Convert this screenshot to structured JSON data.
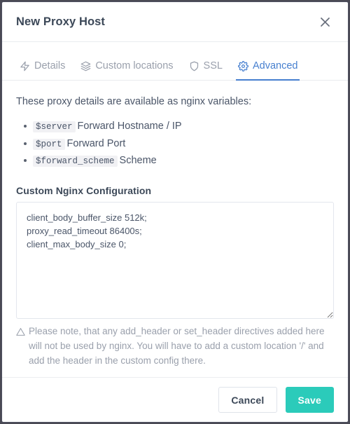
{
  "dialog": {
    "title": "New Proxy Host",
    "close_icon": "close-icon"
  },
  "tabs": [
    {
      "label": "Details",
      "icon": "zap-icon",
      "active": false
    },
    {
      "label": "Custom locations",
      "icon": "layers-icon",
      "active": false
    },
    {
      "label": "SSL",
      "icon": "shield-icon",
      "active": false
    },
    {
      "label": "Advanced",
      "icon": "gear-icon",
      "active": true
    }
  ],
  "body": {
    "intro": "These proxy details are available as nginx variables:",
    "variables": [
      {
        "name": "$server",
        "desc": "Forward Hostname / IP"
      },
      {
        "name": "$port",
        "desc": "Forward Port"
      },
      {
        "name": "$forward_scheme",
        "desc": "Scheme"
      }
    ],
    "config_label": "Custom Nginx Configuration",
    "config_value": "client_body_buffer_size 512k;\nproxy_read_timeout 86400s;\nclient_max_body_size 0;",
    "config_placeholder": "",
    "note_icon": "warning-triangle-icon",
    "note": "Please note, that any add_header or set_header directives added here will not be used by nginx. You will have to add a custom location '/' and add the header in the custom config there."
  },
  "footer": {
    "cancel_label": "Cancel",
    "save_label": "Save"
  },
  "colors": {
    "accent_blue": "#467fcf",
    "save_teal": "#2bcbba",
    "title_text": "#3c4858",
    "muted_text": "#9aa0ac"
  }
}
